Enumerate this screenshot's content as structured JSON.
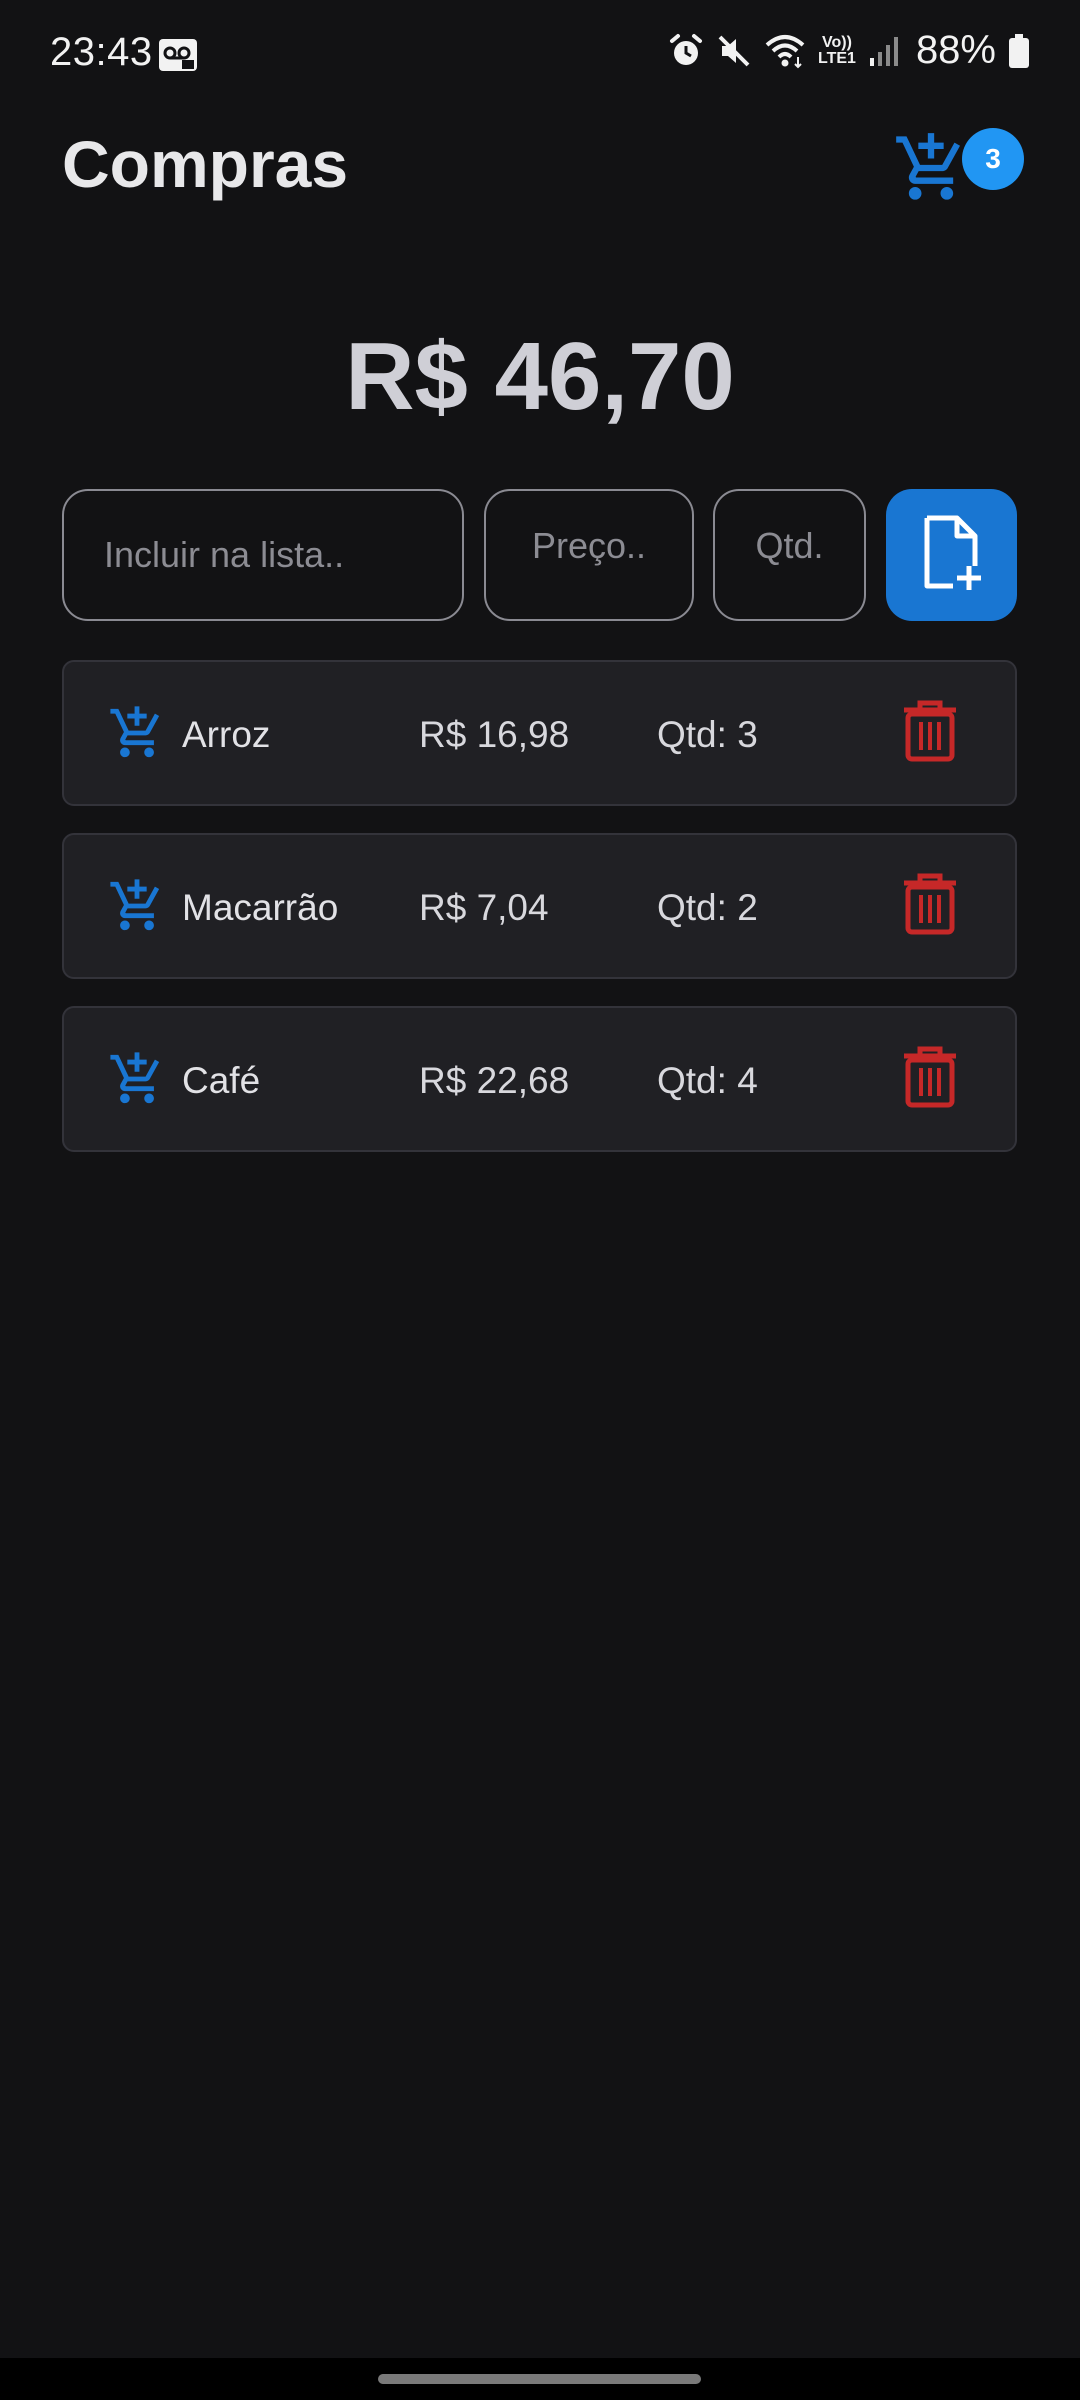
{
  "status_bar": {
    "time": "23:43",
    "battery": "88%",
    "network_label_top": "Vo))",
    "network_label_bottom": "LTE1",
    "icons": [
      "voicemail-icon",
      "alarm-icon",
      "mute-icon",
      "wifi-icon",
      "signal-icon",
      "battery-icon"
    ]
  },
  "header": {
    "title": "Compras",
    "cart_count": "3"
  },
  "summary": {
    "total": "R$ 46,70"
  },
  "form": {
    "item_placeholder": "Incluir na lista..",
    "price_placeholder": "Preço..",
    "qty_placeholder": "Qtd.",
    "add_icon": "file-plus-icon"
  },
  "items": [
    {
      "name": "Arroz",
      "price": "R$ 16,98",
      "qty": "Qtd: 3"
    },
    {
      "name": "Macarrão",
      "price": "R$ 7,04",
      "qty": "Qtd: 2"
    },
    {
      "name": "Café",
      "price": "R$ 22,68",
      "qty": "Qtd: 4"
    }
  ],
  "colors": {
    "background": "#121214",
    "accent": "#1976d2",
    "badge": "#2196f3",
    "delete": "#c62828",
    "card": "#202024"
  }
}
